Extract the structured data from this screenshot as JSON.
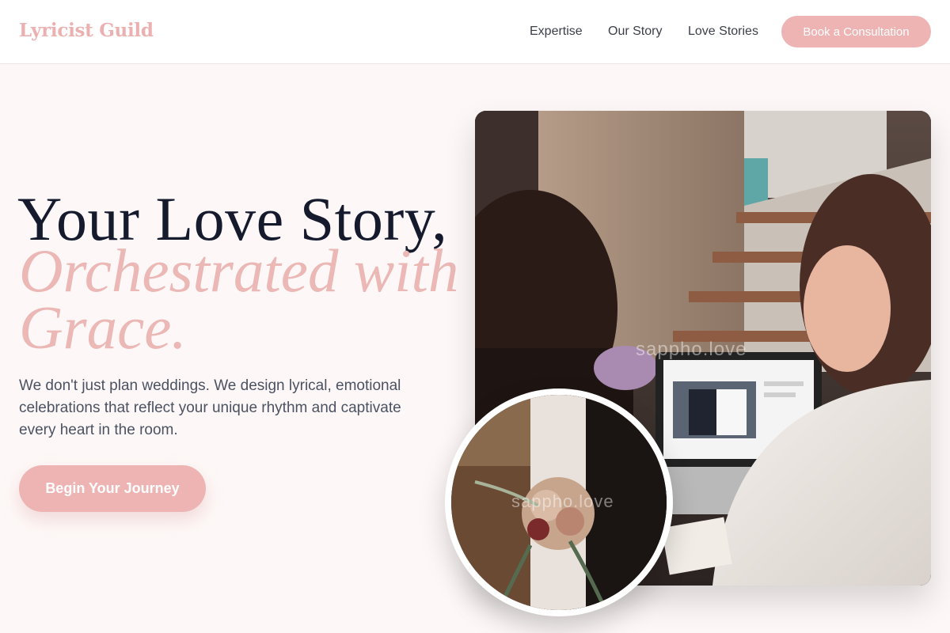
{
  "header": {
    "logo": "Lyricist Guild",
    "nav": [
      "Expertise",
      "Our Story",
      "Love Stories"
    ],
    "cta": "Book a Consultation"
  },
  "hero": {
    "title_line1": "Your Love Story,",
    "title_accent": "Orchestrated with Grace.",
    "subtitle": "We don't just plan weddings. We design lyrical, emotional celebrations that reflect your unique rhythm and captivate every heart in the room.",
    "cta": "Begin Your Journey"
  },
  "images": {
    "main_watermark": "sappho.love",
    "bouquet_watermark": "sappho.love"
  },
  "colors": {
    "accent": "#ebb1b1",
    "button": "#edb4b3",
    "heading": "#151a2d",
    "body_text": "#4b5262",
    "background": "#fdf8f7"
  }
}
